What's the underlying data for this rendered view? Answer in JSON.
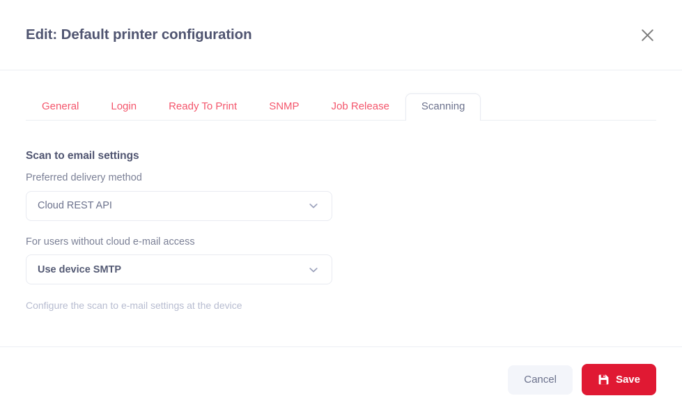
{
  "dialog": {
    "title": "Edit: Default printer configuration",
    "close_icon": "close-icon"
  },
  "tabs": [
    {
      "label": "General",
      "active": false
    },
    {
      "label": "Login",
      "active": false
    },
    {
      "label": "Ready To Print",
      "active": false
    },
    {
      "label": "SNMP",
      "active": false
    },
    {
      "label": "Job Release",
      "active": false
    },
    {
      "label": "Scanning",
      "active": true
    }
  ],
  "panel": {
    "heading": "Scan to email settings",
    "fields": [
      {
        "label": "Preferred delivery method",
        "value": "Cloud REST API",
        "chevron_icon": "chevron-down-icon"
      },
      {
        "label": "For users without cloud e-mail access",
        "value": "Use device SMTP",
        "chevron_icon": "chevron-down-icon"
      }
    ],
    "helper_text": "Configure the scan to e-mail settings at the device"
  },
  "footer": {
    "cancel_label": "Cancel",
    "save_label": "Save",
    "save_icon": "save-floppy-icon"
  },
  "colors": {
    "accent_red": "#e01933",
    "tab_inactive": "#f4566c",
    "tab_active_text": "#6b718c",
    "title": "#4f5470",
    "helper": "#b7bcd0",
    "border": "#e8eaf1"
  }
}
